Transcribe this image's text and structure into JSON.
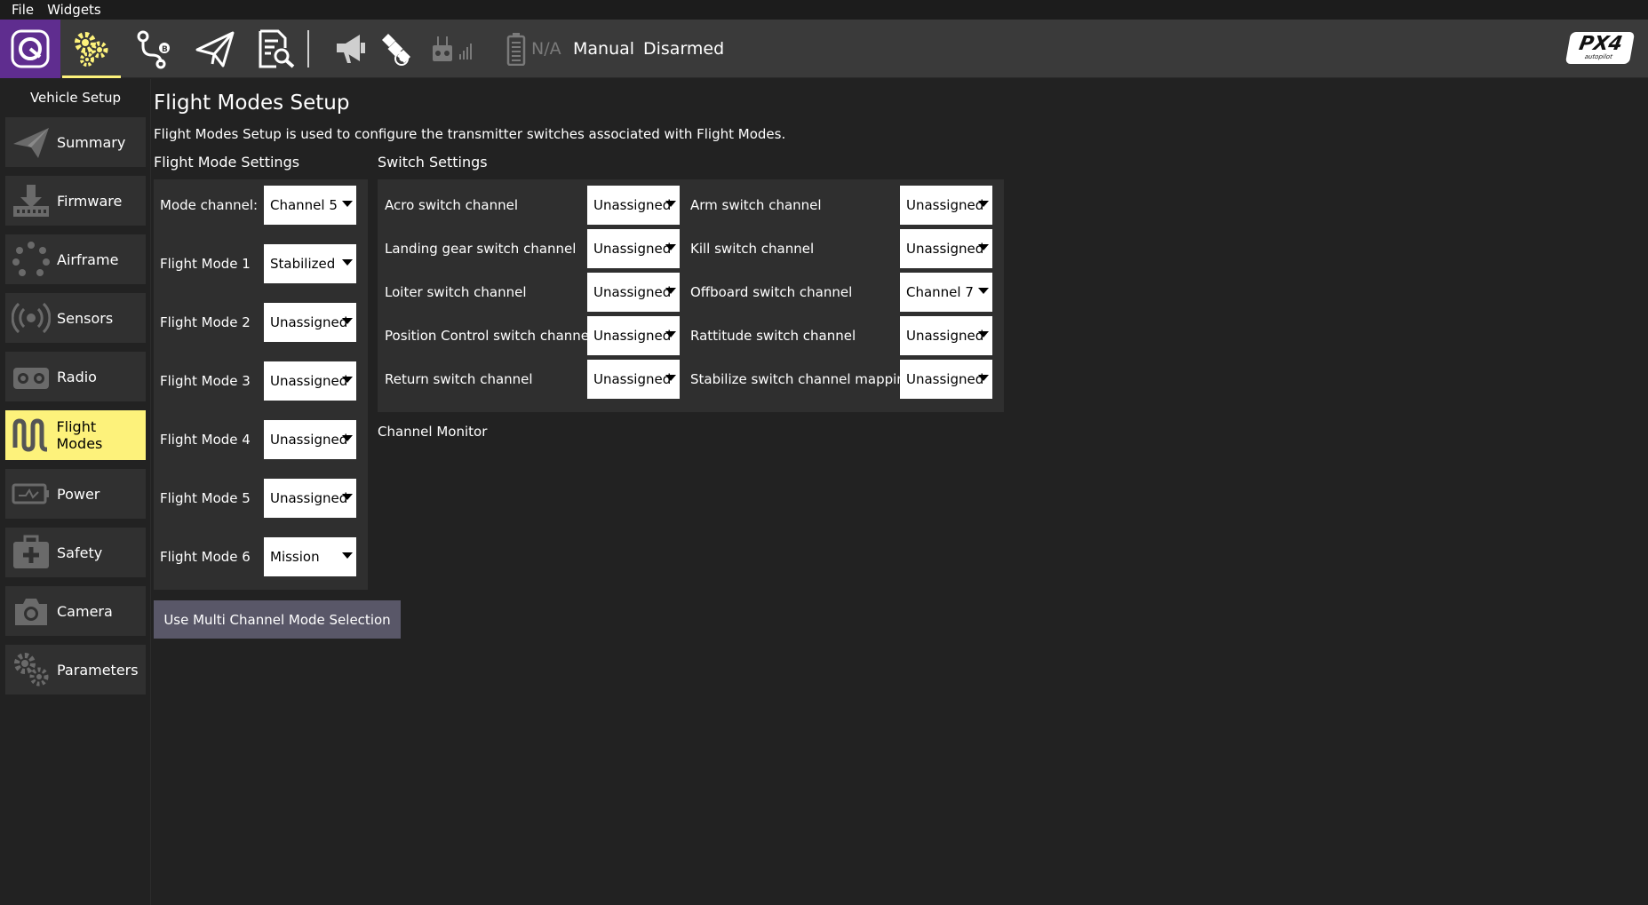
{
  "menu": {
    "file": "File",
    "widgets": "Widgets"
  },
  "toolbar": {
    "battery_text": "N/A",
    "flight_mode": "Manual",
    "arm_state": "Disarmed",
    "logo_big": "PX4",
    "logo_small": "autopilot",
    "accent_color": "#fdf27b",
    "q_button_color": "#5f2d8f"
  },
  "sidebar": {
    "title": "Vehicle Setup",
    "items": [
      {
        "label": "Summary",
        "icon": "paper-plane-icon"
      },
      {
        "label": "Firmware",
        "icon": "download-icon"
      },
      {
        "label": "Airframe",
        "icon": "airframe-icon"
      },
      {
        "label": "Sensors",
        "icon": "sensors-icon"
      },
      {
        "label": "Radio",
        "icon": "radio-icon"
      },
      {
        "label": "Flight Modes",
        "icon": "flight-modes-icon",
        "active": true
      },
      {
        "label": "Power",
        "icon": "battery-icon"
      },
      {
        "label": "Safety",
        "icon": "first-aid-icon"
      },
      {
        "label": "Camera",
        "icon": "camera-icon"
      },
      {
        "label": "Parameters",
        "icon": "gears-icon"
      }
    ]
  },
  "page": {
    "title": "Flight Modes Setup",
    "description": "Flight Modes Setup is used to configure the transmitter switches associated with Flight Modes.",
    "flight_mode_settings_title": "Flight Mode Settings",
    "switch_settings_title": "Switch Settings",
    "channel_monitor_title": "Channel Monitor",
    "multi_channel_button": "Use Multi Channel Mode Selection"
  },
  "flight_mode_settings": [
    {
      "label": "Mode channel:",
      "value": "Channel 5"
    },
    {
      "label": "Flight Mode 1",
      "value": "Stabilized"
    },
    {
      "label": "Flight Mode 2",
      "value": "Unassigned"
    },
    {
      "label": "Flight Mode 3",
      "value": "Unassigned"
    },
    {
      "label": "Flight Mode 4",
      "value": "Unassigned"
    },
    {
      "label": "Flight Mode 5",
      "value": "Unassigned"
    },
    {
      "label": "Flight Mode 6",
      "value": "Mission"
    }
  ],
  "switch_settings": {
    "left": [
      {
        "label": "Acro switch channel",
        "value": "Unassigned"
      },
      {
        "label": "Landing gear switch channel",
        "value": "Unassigned"
      },
      {
        "label": "Loiter switch channel",
        "value": "Unassigned"
      },
      {
        "label": "Position Control switch channel",
        "value": "Unassigned"
      },
      {
        "label": "Return switch channel",
        "value": "Unassigned"
      }
    ],
    "right": [
      {
        "label": "Arm switch channel",
        "value": "Unassigned"
      },
      {
        "label": "Kill switch channel",
        "value": "Unassigned"
      },
      {
        "label": "Offboard switch channel",
        "value": "Channel 7"
      },
      {
        "label": "Rattitude switch channel",
        "value": "Unassigned"
      },
      {
        "label": "Stabilize switch channel mapping",
        "value": "Unassigned"
      }
    ]
  }
}
